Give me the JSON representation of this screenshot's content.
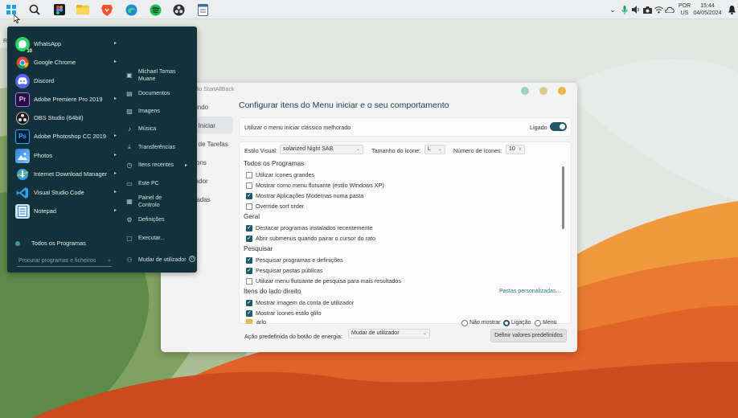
{
  "taskbar": {
    "icons": [
      "start-icon",
      "search-icon",
      "figma-icon",
      "file-explorer-icon",
      "brave-icon",
      "edge-icon",
      "spotify-icon",
      "obs-icon",
      "notepad-icon"
    ],
    "tray": {
      "lang_top": "POR",
      "lang_bottom": "US",
      "time": "15:44",
      "date": "04/05/2024"
    }
  },
  "desktop": {
    "recycle_label": "R"
  },
  "start_menu": {
    "programs": [
      {
        "label": "WhatsApp",
        "badge": "10",
        "arrow": "▸"
      },
      {
        "label": "Google Chrome",
        "arrow": "▸"
      },
      {
        "label": "Discord",
        "arrow": ""
      },
      {
        "label": "Adobe Premiere Pro 2019",
        "glyph": "Pr",
        "arrow": "▸"
      },
      {
        "label": "OBS Studio (64bit)",
        "arrow": ""
      },
      {
        "label": "Adobe Photoshop CC 2019",
        "glyph": "Ps",
        "arrow": "▸"
      },
      {
        "label": "Photos",
        "arrow": "▸"
      },
      {
        "label": "Internet Download Manager",
        "arrow": "▸"
      },
      {
        "label": "Visual Studio Code",
        "arrow": "▸"
      },
      {
        "label": "Notepad",
        "arrow": "▸"
      }
    ],
    "all_programs": "Todos os Programas",
    "search_placeholder": "Procurar programas e ficheiros",
    "right_items": [
      {
        "label": "Michael Tomas Muane",
        "icon": "user-icon"
      },
      {
        "label": "Documentos",
        "icon": "documents-icon"
      },
      {
        "label": "Imagens",
        "icon": "images-icon"
      },
      {
        "label": "Música",
        "icon": "music-icon"
      },
      {
        "label": "Transferências",
        "icon": "downloads-icon"
      },
      {
        "label": "Itens recentes",
        "icon": "recent-icon",
        "arrow": "▸"
      },
      {
        "label": "Este PC",
        "icon": "pc-icon"
      },
      {
        "label": "Painel de Controlo",
        "icon": "control-panel-icon"
      },
      {
        "label": "Definições",
        "icon": "settings-icon"
      },
      {
        "label": "Executar...",
        "icon": "run-icon"
      }
    ],
    "switch_user": "Mudar de utilizador"
  },
  "settings_window": {
    "title": "ção StartAllBack",
    "nav": [
      "vindo",
      "a Iniciar",
      "a de Tarefas",
      "cons",
      "rador",
      "gadas",
      "e"
    ],
    "heading": "Configurar itens do Menu iniciar e o seu comportamento",
    "classic_menu_label": "Utilizar o menu iniciar clássico melhorado",
    "classic_menu_state": "Ligado",
    "style_label": "Estilo Visual:",
    "style_value": "solarized Night SAB",
    "icon_size_label": "Tamanho do ícone:",
    "icon_size_value": "L",
    "icon_count_label": "Número de ícones:",
    "icon_count_value": "10",
    "sections": [
      {
        "title": "Todos os Programas",
        "items": [
          {
            "label": "Utilizar ícones grandes",
            "checked": false
          },
          {
            "label": "Mostrar como menu flutuante (estilo Windows XP)",
            "checked": false
          },
          {
            "label": "Mostrar Aplicações Modernas numa pasta",
            "checked": true
          },
          {
            "label": "Override sort order",
            "checked": false
          }
        ]
      },
      {
        "title": "Geral",
        "items": [
          {
            "label": "Destacar programas instalados recentemente",
            "checked": true
          },
          {
            "label": "Abrir submenus quando pairar o cursor do rato",
            "checked": true
          }
        ]
      },
      {
        "title": "Pesquisar",
        "items": [
          {
            "label": "Pesquisar programas e definições",
            "checked": true
          },
          {
            "label": "Pesquisar pastas públicas",
            "checked": true
          },
          {
            "label": "Utilizar menu flutuante de pesquisa para mais resultados",
            "checked": false
          }
        ]
      },
      {
        "title": "Itens do lado direito",
        "items": [
          {
            "label": "Mostrar imagem da conta de utilizador",
            "checked": true
          },
          {
            "label": "Mostrar ícones estilo glifo",
            "checked": true
          }
        ]
      }
    ],
    "custom_folders_link": "Pastas personalizadas...",
    "partial_row_label": "arlo",
    "radio_options": [
      "Não mostrar",
      "Ligação",
      "Menu"
    ],
    "power_action_label": "Ação predefinida do botão de energia:",
    "power_action_value": "Mudar de utilizador",
    "reset_button": "Definir valores predefinidos"
  },
  "colors": {
    "start_bg": "#12313a",
    "accent": "#1f5b66",
    "wallpaper_green": "#7ea35f",
    "wallpaper_orange": "#e46a2c"
  }
}
